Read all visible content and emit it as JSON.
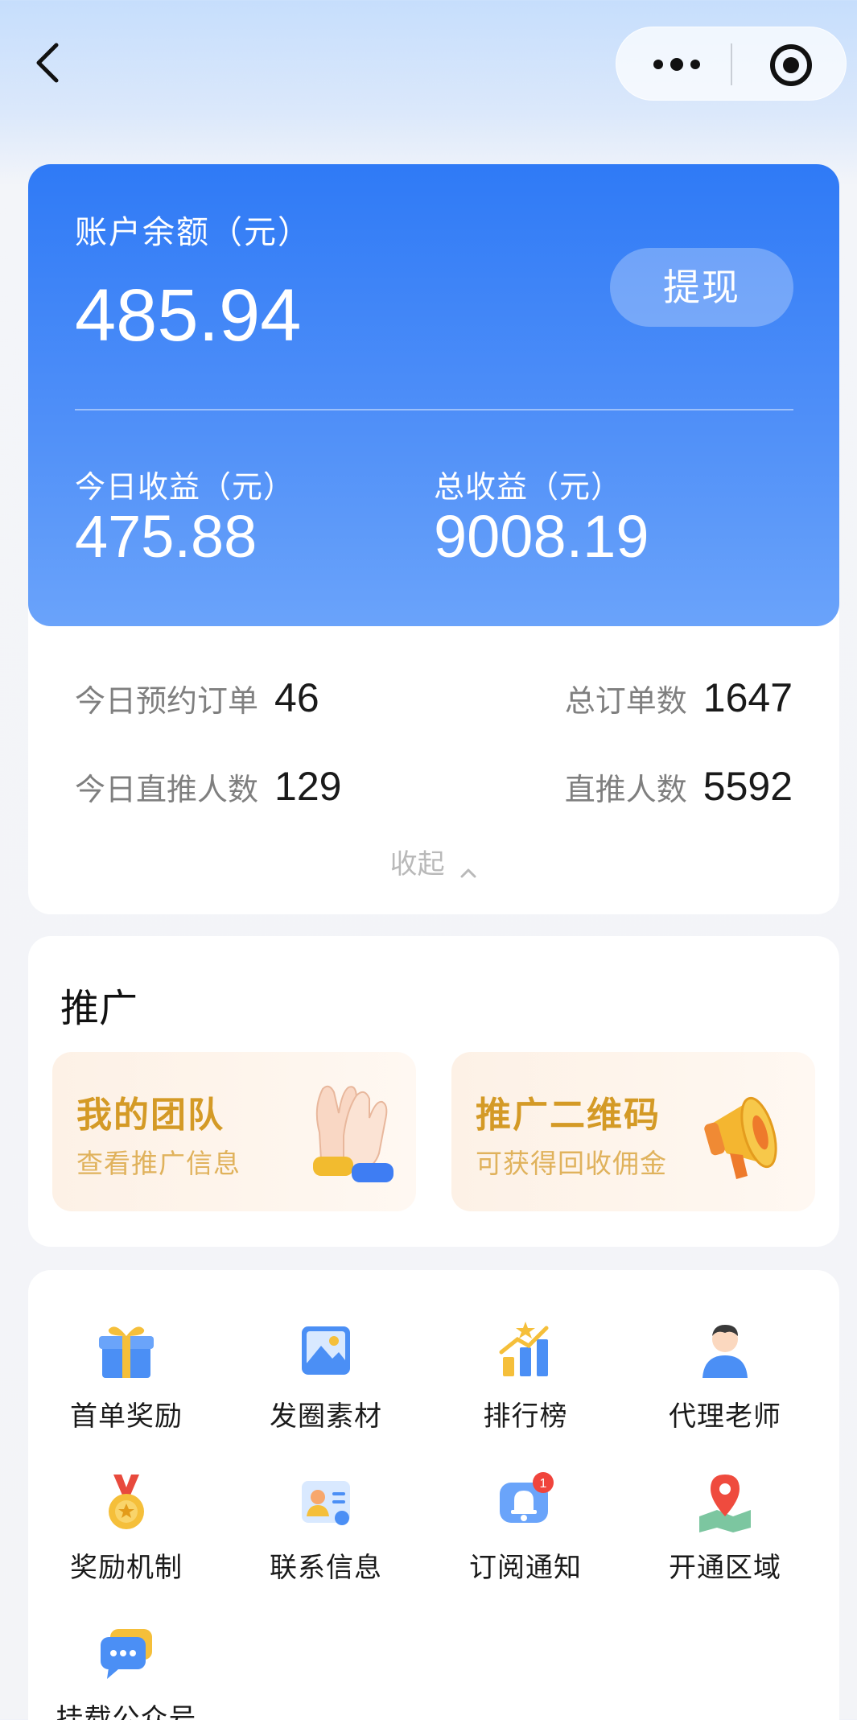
{
  "nav": {
    "back_icon": "back-arrow-icon",
    "more_icon": "more-dots-icon",
    "close_icon": "target-circle-icon"
  },
  "balance": {
    "label": "账户余额（元）",
    "value": "485.94",
    "withdraw_label": "提现",
    "today_label": "今日收益（元）",
    "today_value": "475.88",
    "total_label": "总收益（元）",
    "total_value": "9008.19"
  },
  "orders": {
    "today_orders_label": "今日预约订单",
    "today_orders_value": "46",
    "total_orders_label": "总订单数",
    "total_orders_value": "1647",
    "today_direct_label": "今日直推人数",
    "today_direct_value": "129",
    "direct_label": "直推人数",
    "direct_value": "5592",
    "collapse_label": "收起"
  },
  "promo": {
    "title": "推广",
    "tiles": [
      {
        "title": "我的团队",
        "subtitle": "查看推广信息",
        "icon": "high-five-hands-icon"
      },
      {
        "title": "推广二维码",
        "subtitle": "可获得回收佣金",
        "icon": "megaphone-icon"
      }
    ]
  },
  "grid": {
    "items": [
      {
        "label": "首单奖励",
        "icon": "gift-box-icon"
      },
      {
        "label": "发圈素材",
        "icon": "image-icon"
      },
      {
        "label": "排行榜",
        "icon": "ranking-chart-icon"
      },
      {
        "label": "代理老师",
        "icon": "person-icon"
      },
      {
        "label": "奖励机制",
        "icon": "medal-icon"
      },
      {
        "label": "联系信息",
        "icon": "contact-card-icon"
      },
      {
        "label": "订阅通知",
        "icon": "bell-icon"
      },
      {
        "label": "开通区域",
        "icon": "map-pin-icon"
      },
      {
        "label": "挂载公众号",
        "icon": "chat-bubble-icon"
      }
    ],
    "bell_badge": "1"
  },
  "colors": {
    "accent": "#2f7af6",
    "promo_text": "#d49a26"
  }
}
